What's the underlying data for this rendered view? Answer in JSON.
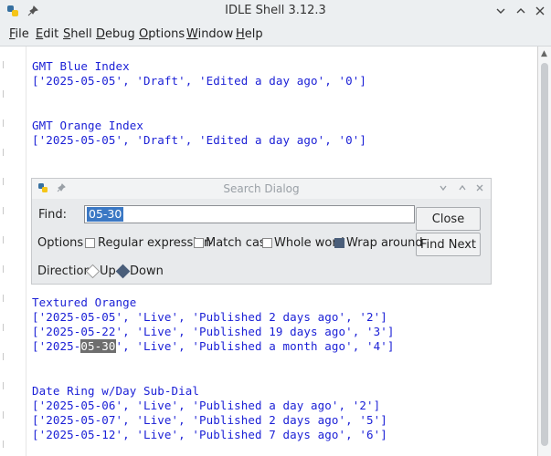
{
  "window": {
    "title": "IDLE Shell 3.12.3"
  },
  "menu": [
    "File",
    "Edit",
    "Shell",
    "Debug",
    "Options",
    "Window",
    "Help"
  ],
  "lines": [
    "GMT Blue Index",
    "['2025-05-05', 'Draft', 'Edited a day ago', '0']",
    "GMT Orange Index",
    "['2025-05-05', 'Draft', 'Edited a day ago', '0']",
    "Textured Orange",
    "['2025-05-05', 'Live', 'Published 2 days ago', '2']",
    "['2025-05-22', 'Live', 'Published 19 days ago', '3']",
    "['2025-",
    "05-30",
    "', 'Live', 'Published a month ago', '4']",
    "Date Ring w/Day Sub-Dial",
    "['2025-05-06', 'Live', 'Published a day ago', '2']",
    "['2025-05-07', 'Live', 'Published 2 days ago', '5']",
    "['2025-05-12', 'Live', 'Published 7 days ago', '6']"
  ],
  "search_dialog": {
    "title": "Search Dialog",
    "find_label": "Find:",
    "find_value": "05-30",
    "close_label": "Close",
    "find_next_label": "Find Next",
    "options_label": "Options",
    "options": [
      {
        "label": "Regular expression",
        "checked": false
      },
      {
        "label": "Match case",
        "checked": false
      },
      {
        "label": "Whole word",
        "checked": false
      },
      {
        "label": "Wrap around",
        "checked": true
      }
    ],
    "direction_label": "Direction",
    "direction_up": "Up",
    "direction_down": "Down",
    "direction_selected": "Down"
  }
}
